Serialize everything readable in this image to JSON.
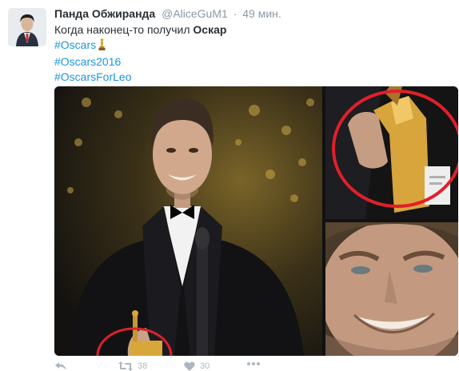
{
  "tweet": {
    "author_name": "Панда Обжиранда",
    "handle": "@AliceGuM1",
    "separator": "·",
    "time": "49 мин.",
    "text_prefix": "Когда наконец-то получил ",
    "text_bold": "Оскар",
    "hashtags": [
      "#Oscars",
      "#Oscars2016",
      "#OscarsForLeo"
    ],
    "oscar_icon": "oscar-statuette-emoji"
  },
  "actions": {
    "retweet_count": "38",
    "like_count": "30"
  },
  "colors": {
    "link": "#1b95e0",
    "meta": "#8899a6",
    "highlight_circle": "#e0202a"
  }
}
